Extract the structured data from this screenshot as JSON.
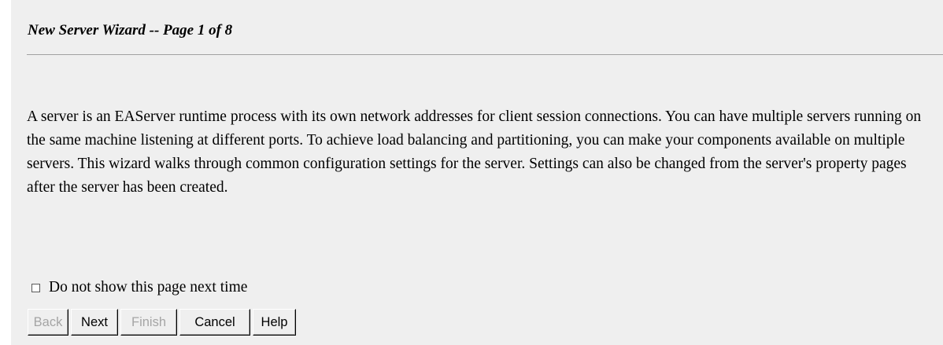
{
  "wizard": {
    "title": "New Server Wizard -- Page 1 of 8",
    "description": "A server is an EAServer runtime process with its own network addresses for client session connections. You can have multiple servers running on the same machine listening at different ports. To achieve load balancing and partitioning, you can make your components available on multiple servers. This wizard walks through common configuration settings for the server. Settings can also be changed from the server's property pages after the server has been created."
  },
  "option": {
    "label": "Do not show this page next time",
    "checked": false
  },
  "buttons": {
    "back": "Back",
    "next": "Next",
    "finish": "Finish",
    "cancel": "Cancel",
    "help": "Help"
  },
  "colors": {
    "panel_background": "#efefef",
    "disabled_text": "#a5a5a5",
    "divider": "#a0a0a0"
  }
}
